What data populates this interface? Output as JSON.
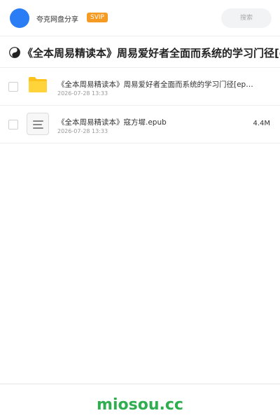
{
  "header": {
    "app_name": "夸克网盘分享",
    "badge": "SVIP",
    "search_placeholder": "搜索",
    "avatar_color": "#2a7df5",
    "badge_color": "#f59a23"
  },
  "share": {
    "title": "《全本周易精读本》周易爱好者全面而系统的学习门径[epub]"
  },
  "files": [
    {
      "type": "folder",
      "icon": "folder-icon",
      "name": "《全本周易精读本》周易爱好者全面而系统的学习门径[epub]",
      "date": "2026-07-28 13:33",
      "size": ""
    },
    {
      "type": "document",
      "icon": "document-icon",
      "name": "《全本周易精读本》寇方墀.epub",
      "date": "2026-07-28 13:33",
      "size": "4.4M"
    }
  ],
  "footer": {
    "watermark": "miosou.cc",
    "watermark_color": "#2fae4f"
  }
}
